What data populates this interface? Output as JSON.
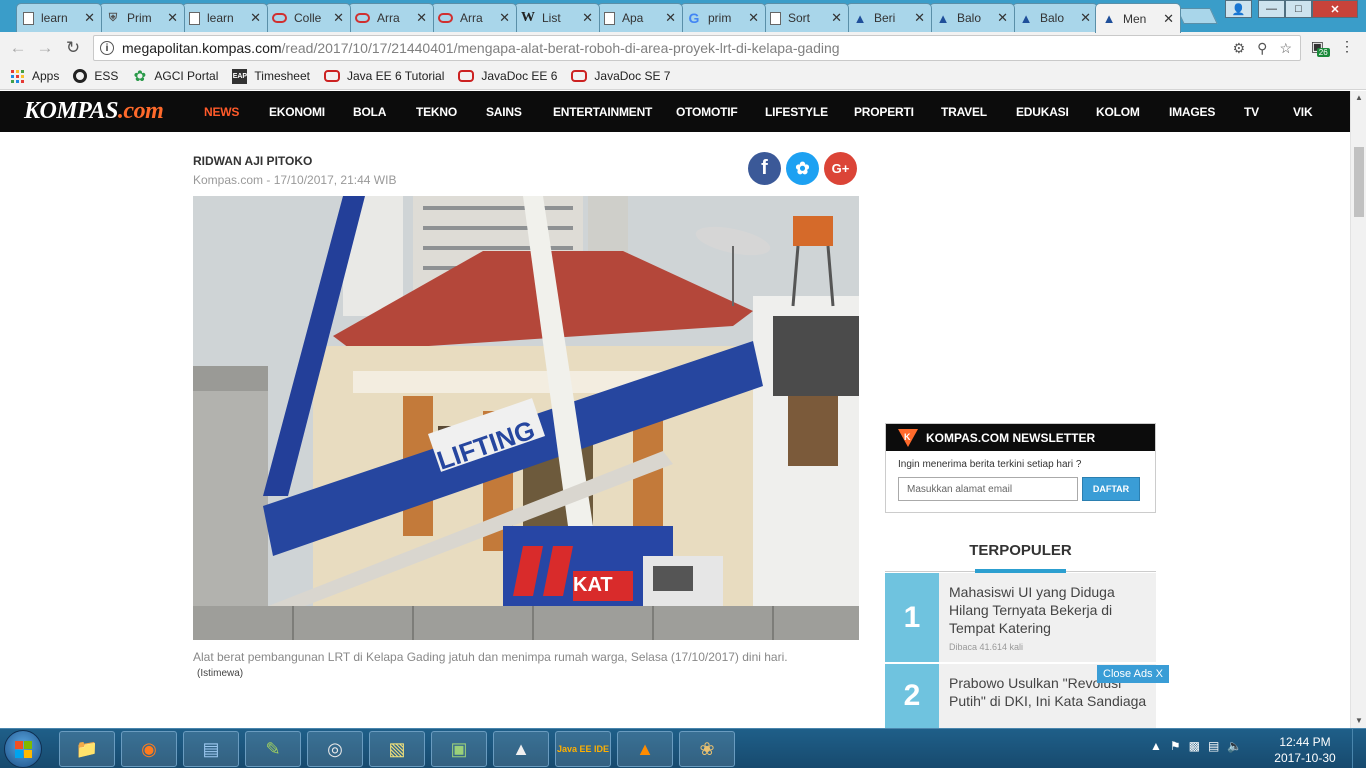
{
  "browser": {
    "tabs": [
      {
        "label": "learn",
        "icon": "doc"
      },
      {
        "label": "Prim",
        "icon": "shield"
      },
      {
        "label": "learn",
        "icon": "doc"
      },
      {
        "label": "Colle",
        "icon": "oracle"
      },
      {
        "label": "Arra",
        "icon": "oracle"
      },
      {
        "label": "Arra",
        "icon": "oracle"
      },
      {
        "label": "List",
        "icon": "wiki"
      },
      {
        "label": "Apa",
        "icon": "doc"
      },
      {
        "label": "prim",
        "icon": "google"
      },
      {
        "label": "Sort",
        "icon": "doc"
      },
      {
        "label": "Beri",
        "icon": "kompas"
      },
      {
        "label": "Balo",
        "icon": "kompas"
      },
      {
        "label": "Balo",
        "icon": "kompas"
      },
      {
        "label": "Men",
        "icon": "kompas"
      }
    ],
    "url_host": "megapolitan.kompas.com",
    "url_path": "/read/2017/10/17/21440401/mengapa-alat-berat-roboh-di-area-proyek-lrt-di-kelapa-gading",
    "extension_badge": "26",
    "bookmarks": [
      {
        "label": "Apps",
        "icon": "apps-grid"
      },
      {
        "label": "ESS",
        "icon": "ess"
      },
      {
        "label": "AGCI Portal",
        "icon": "agci"
      },
      {
        "label": "Timesheet",
        "icon": "timesheet"
      },
      {
        "label": "Java EE 6 Tutorial",
        "icon": "oracle"
      },
      {
        "label": "JavaDoc EE 6",
        "icon": "oracle"
      },
      {
        "label": "JavaDoc SE 7",
        "icon": "oracle"
      }
    ]
  },
  "site": {
    "logo_main": "KOMPAS",
    "logo_suffix": ".com",
    "nav": [
      "NEWS",
      "EKONOMI",
      "BOLA",
      "TEKNO",
      "SAINS",
      "ENTERTAINMENT",
      "OTOMOTIF",
      "LIFESTYLE",
      "PROPERTI",
      "TRAVEL",
      "EDUKASI",
      "KOLOM",
      "IMAGES",
      "TV",
      "VIK"
    ],
    "active_nav": "NEWS"
  },
  "article": {
    "author": "RIDWAN AJI PITOKO",
    "dateline": "Kompas.com - 17/10/2017, 21:44 WIB",
    "photo_text": "LIFTING",
    "crane_text": "KAT",
    "caption": "Alat berat pembangunan LRT di Kelapa Gading jatuh dan menimpa rumah warga, Selasa (17/10/2017) dini hari.",
    "credit": "(Istimewa)"
  },
  "sidebar": {
    "newsletter": {
      "title": "KOMPAS.COM NEWSLETTER",
      "prompt": "Ingin menerima berita terkini setiap hari ?",
      "placeholder": "Masukkan alamat email",
      "button": "DAFTAR"
    },
    "terpopuler": {
      "title": "TERPOPULER",
      "items": [
        {
          "rank": "1",
          "title": "Mahasiswi UI yang Diduga Hilang Ternyata Bekerja di Tempat Katering",
          "meta": "Dibaca 41.614 kali"
        },
        {
          "rank": "2",
          "title": "Prabowo Usulkan \"Revolusi Putih\" di DKI, Ini Kata Sandiaga",
          "meta": ""
        }
      ]
    },
    "close_ads": "Close Ads X"
  },
  "taskbar": {
    "time": "12:44 PM",
    "date": "2017-10-30",
    "apps": [
      "file-explorer",
      "firefox",
      "notepad",
      "notepad-plus",
      "chrome",
      "sticky-notes",
      "system-monitor",
      "inkscape",
      "java-ee-ide",
      "vlc",
      "paint"
    ],
    "java_ee_label": "Java EE IDE"
  },
  "colors": {
    "tabstrip": "#3a9dc9",
    "site_nav": "#0c0c0c",
    "active_nav": "#ff5a2a",
    "accent_blue": "#3a9dd6",
    "popular_rank": "#6fc3df"
  }
}
